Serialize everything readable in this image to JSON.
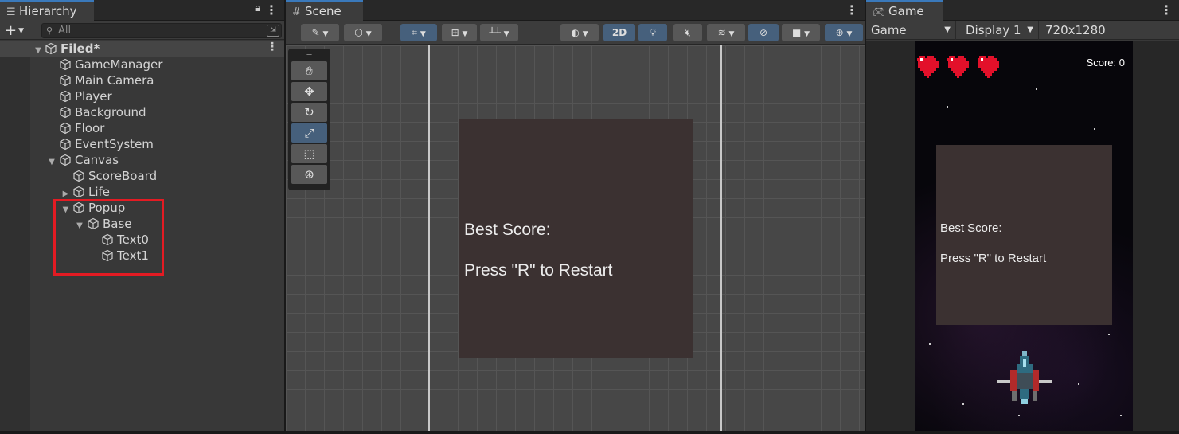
{
  "hierarchy": {
    "tab_title": "Hierarchy",
    "search_placeholder": "All",
    "scene_name": "Filed*",
    "items": [
      {
        "label": "GameManager"
      },
      {
        "label": "Main Camera"
      },
      {
        "label": "Player"
      },
      {
        "label": "Background"
      },
      {
        "label": "Floor"
      },
      {
        "label": "EventSystem"
      },
      {
        "label": "Canvas"
      },
      {
        "label": "ScoreBoard"
      },
      {
        "label": "Life"
      },
      {
        "label": "Popup"
      },
      {
        "label": "Base"
      },
      {
        "label": "Text0"
      },
      {
        "label": "Text1"
      }
    ],
    "highlight_color": "#e31b23"
  },
  "scene": {
    "tab_title": "Scene",
    "toolbar": {
      "mode_2d_label": "2D"
    },
    "popup": {
      "line1": "Best Score:",
      "line2": "Press \"R\" to Restart"
    }
  },
  "game": {
    "tab_title": "Game",
    "view_dropdown": "Game",
    "display_dropdown": "Display 1",
    "resolution": "720x1280",
    "score_text": "Score: 0",
    "lives": 3,
    "popup": {
      "line1": "Best Score:",
      "line2": "Press \"R\" to Restart"
    }
  },
  "colors": {
    "accent": "#3a79bb",
    "active_button": "#46607c",
    "popup_bg": "#3b3131",
    "heart": "#e3102a"
  }
}
